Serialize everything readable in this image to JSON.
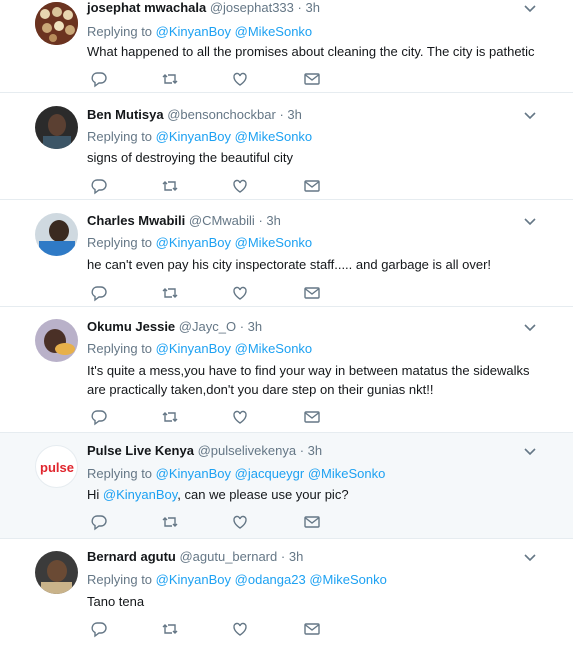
{
  "tweets": [
    {
      "name": "josephat mwachala",
      "handle": "@josephat333",
      "time": "3h",
      "replying_prefix": "Replying to",
      "mentions": [
        "@KinyanBoy",
        "@MikeSonko"
      ],
      "text": "What happened to all the promises about cleaning the city.  The city is pathetic"
    },
    {
      "name": "Ben Mutisya",
      "handle": "@bensonchockbar",
      "time": "3h",
      "replying_prefix": "Replying to",
      "mentions": [
        "@KinyanBoy",
        "@MikeSonko"
      ],
      "text": "signs of destroying the beautiful city"
    },
    {
      "name": "Charles Mwabili",
      "handle": "@CMwabili",
      "time": "3h",
      "replying_prefix": "Replying to",
      "mentions": [
        "@KinyanBoy",
        "@MikeSonko"
      ],
      "text": "he can't even pay his city inspectorate staff..... and garbage is all over!"
    },
    {
      "name": "Okumu Jessie",
      "handle": "@Jayc_O",
      "time": "3h",
      "replying_prefix": "Replying to",
      "mentions": [
        "@KinyanBoy",
        "@MikeSonko"
      ],
      "text": "It's quite a mess,you have to find your way in between matatus the sidewalks are practically taken,don't you dare step on their gunias nkt!!"
    },
    {
      "name": "Pulse Live Kenya",
      "handle": "@pulselivekenya",
      "time": "3h",
      "replying_prefix": "Replying to",
      "mentions": [
        "@KinyanBoy",
        "@jacqueygr",
        "@MikeSonko"
      ],
      "text_pre": "Hi ",
      "text_mention": "@KinyanBoy",
      "text_post": ", can we please use your pic?",
      "avatar_label": "pulse"
    },
    {
      "name": "Bernard agutu",
      "handle": "@agutu_bernard",
      "time": "3h",
      "replying_prefix": "Replying to",
      "mentions": [
        "@KinyanBoy",
        "@odanga23",
        "@MikeSonko"
      ],
      "text": "Tano tena"
    }
  ],
  "separator": "·",
  "icons": {
    "reply": "reply-icon",
    "retweet": "retweet-icon",
    "like": "heart-icon",
    "dm": "envelope-icon",
    "caret": "chevron-down-icon"
  },
  "colors": {
    "link": "#1da1f2",
    "meta": "#657786",
    "icon": "#657786",
    "highlight": "#f5f8fa",
    "pulse_red": "#e0262e"
  }
}
